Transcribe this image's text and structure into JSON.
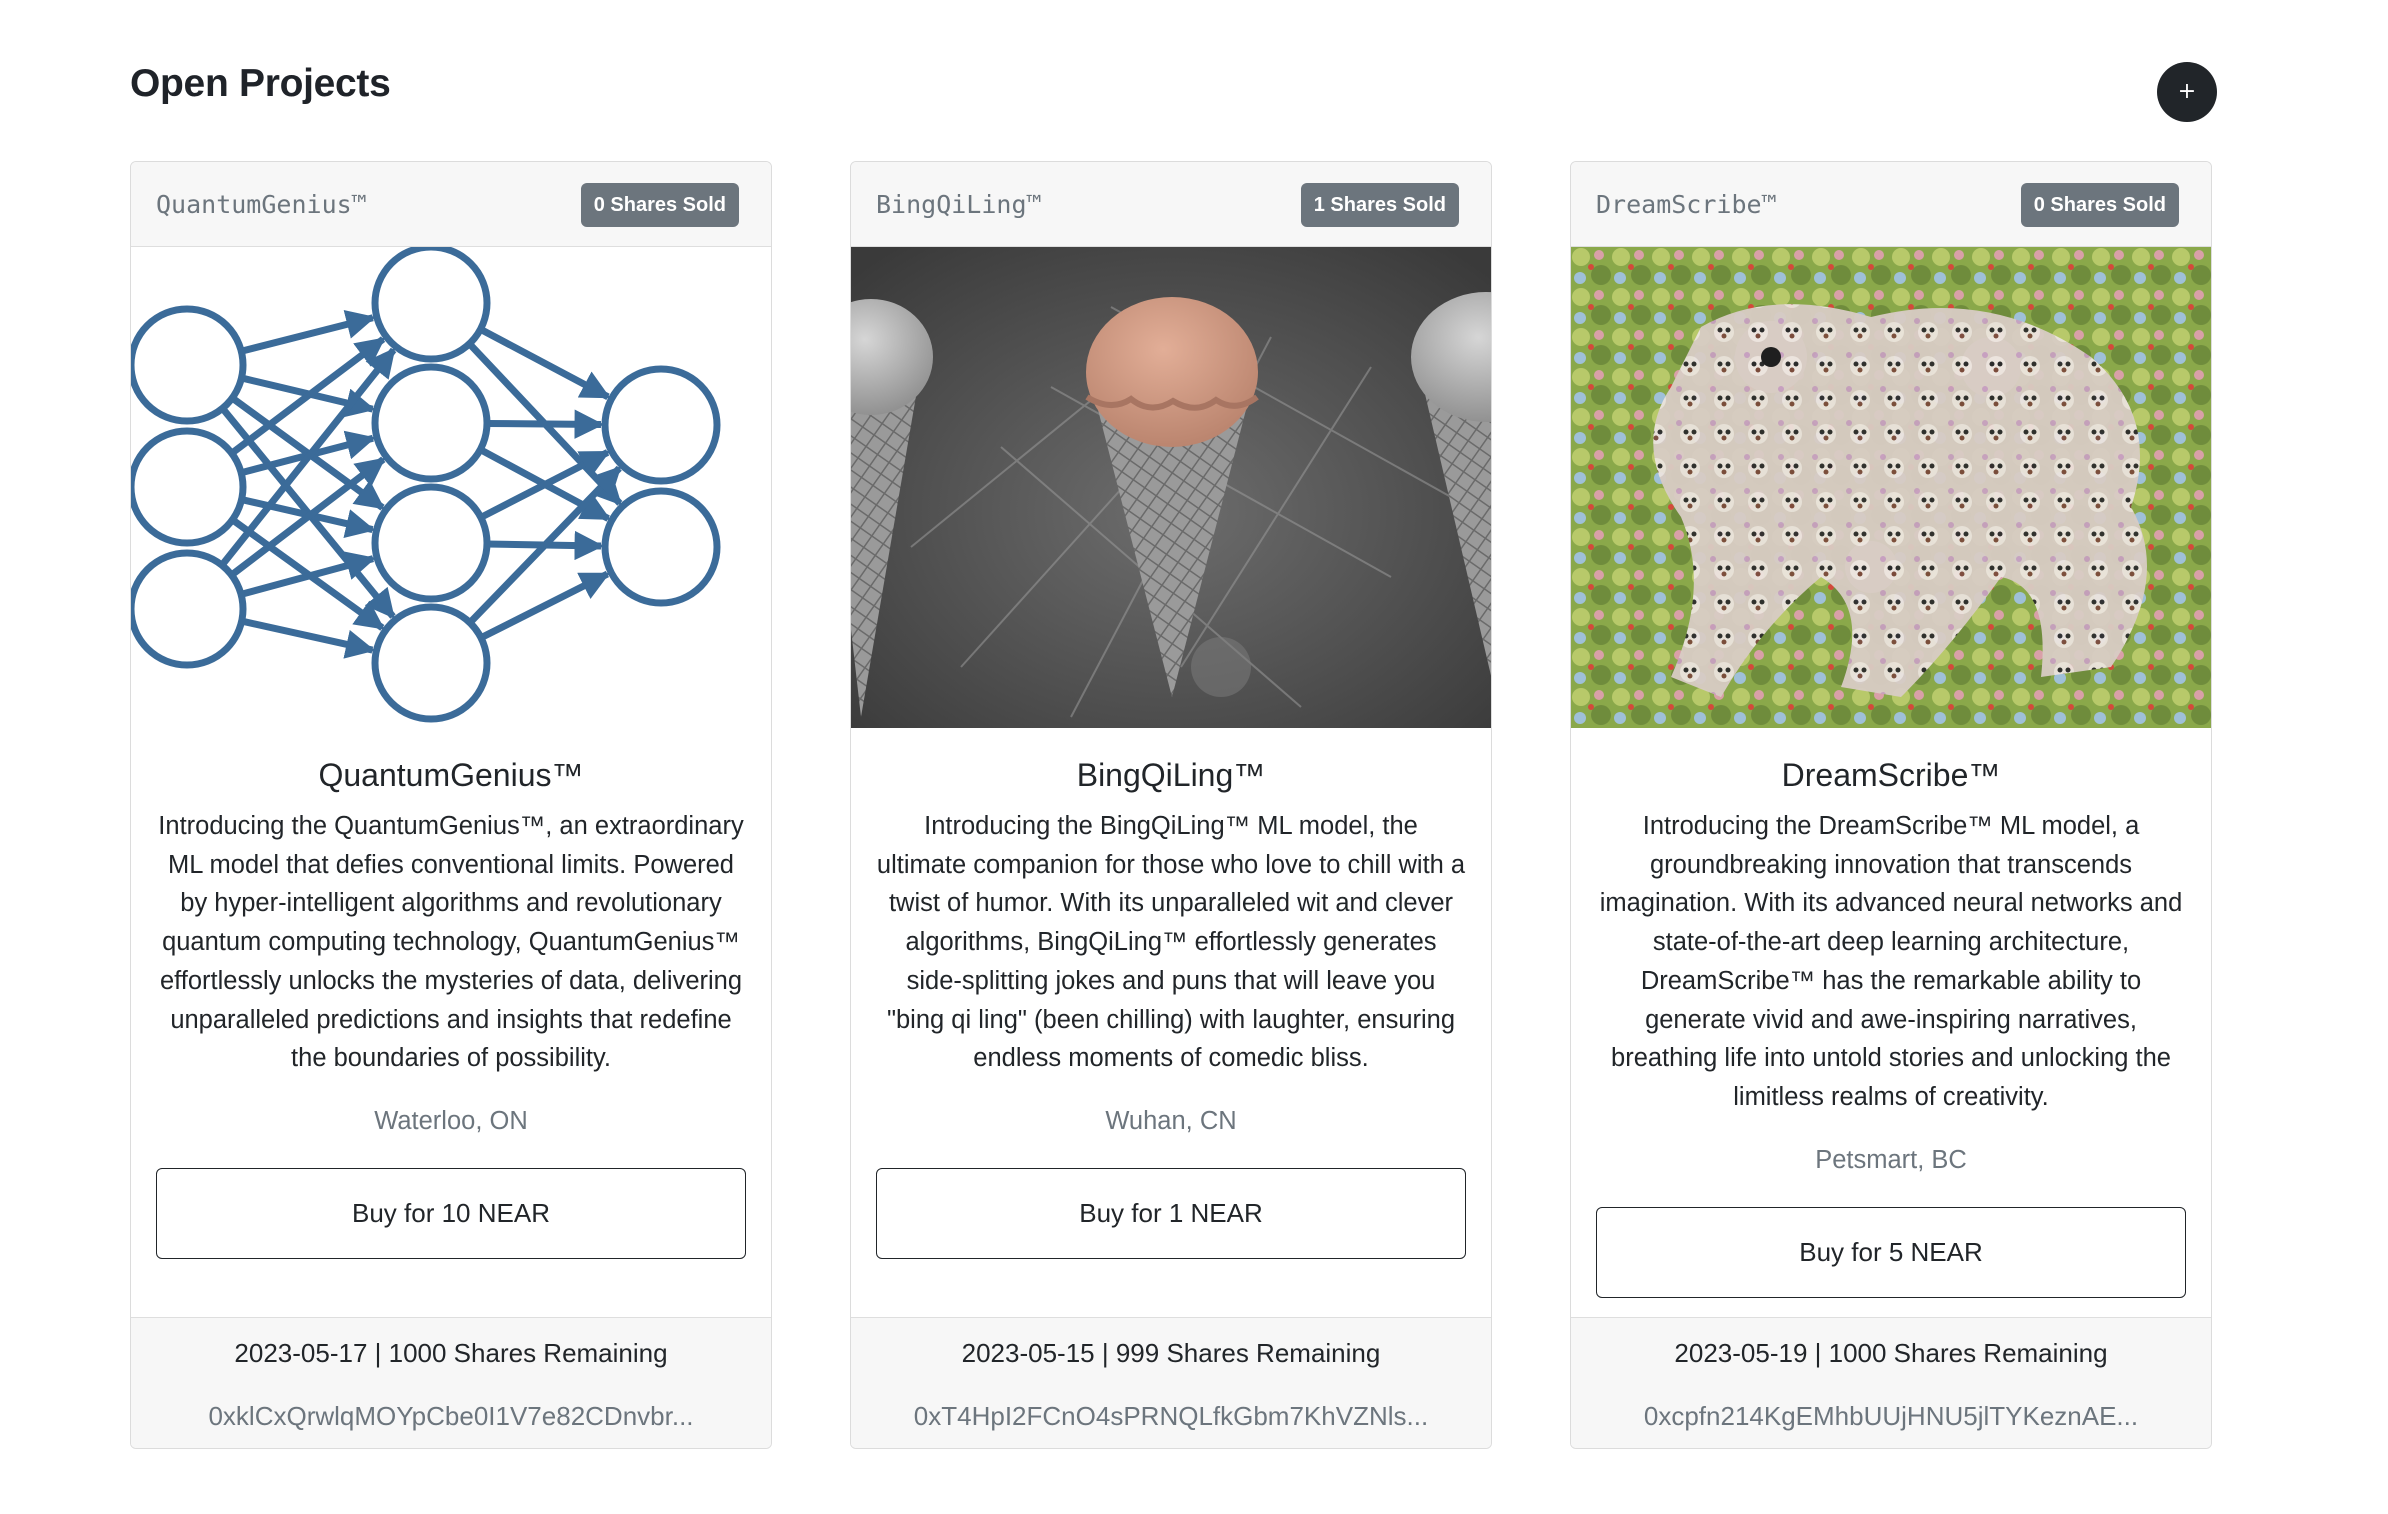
{
  "page": {
    "title": "Open Projects",
    "add_button_label": "+"
  },
  "colors": {
    "badge_bg": "#6c757d",
    "add_button_bg": "#212529",
    "network_blue": "#3b6b99",
    "cone_scoop": "#cf9a82"
  },
  "projects": [
    {
      "code_name": "QuantumGenius™",
      "badge": "0 Shares Sold",
      "image_alt": "neural network diagram",
      "title": "QuantumGenius™",
      "description": "Introducing the QuantumGenius™, an extraordinary ML model that defies conventional limits. Powered by hyper-intelligent algorithms and revolutionary quantum computing technology, QuantumGenius™ effortlessly unlocks the mysteries of data, delivering unparalleled predictions and insights that redefine the boundaries of possibility.",
      "location": "Waterloo, ON",
      "buy_label": "Buy for 10 NEAR",
      "meta": "2023-05-17 | 1000 Shares Remaining",
      "address": "0xklCxQrwlqMOYpCbe0I1V7e82CDnvbr..."
    },
    {
      "code_name": "BingQiLing™",
      "badge": "1 Shares Sold",
      "image_alt": "ice cream cones",
      "title": "BingQiLing™",
      "description": "Introducing the BingQiLing™ ML model, the ultimate companion for those who love to chill with a twist of humor. With its unparalleled wit and clever algorithms, BingQiLing™ effortlessly generates side-splitting jokes and puns that will leave you \"bing qi ling\" (been chilling) with laughter, ensuring endless moments of comedic bliss.",
      "location": "Wuhan, CN",
      "buy_label": "Buy for 1 NEAR",
      "meta": "2023-05-15 | 999 Shares Remaining",
      "address": "0xT4HpI2FCnO4sPRNQLfkGbm7KhVZNls..."
    },
    {
      "code_name": "DreamScribe™",
      "badge": "0 Shares Sold",
      "image_alt": "psychedelic dream image",
      "title": "DreamScribe™",
      "description": "Introducing the DreamScribe™ ML model, a groundbreaking innovation that transcends imagination. With its advanced neural networks and state-of-the-art deep learning architecture, DreamScribe™ has the remarkable ability to generate vivid and awe-inspiring narratives, breathing life into untold stories and unlocking the limitless realms of creativity.",
      "location": "Petsmart, BC",
      "buy_label": "Buy for 5 NEAR",
      "meta": "2023-05-19 | 1000 Shares Remaining",
      "address": "0xcpfn214KgEMhbUUjHNU5jlTYKeznAE..."
    }
  ]
}
